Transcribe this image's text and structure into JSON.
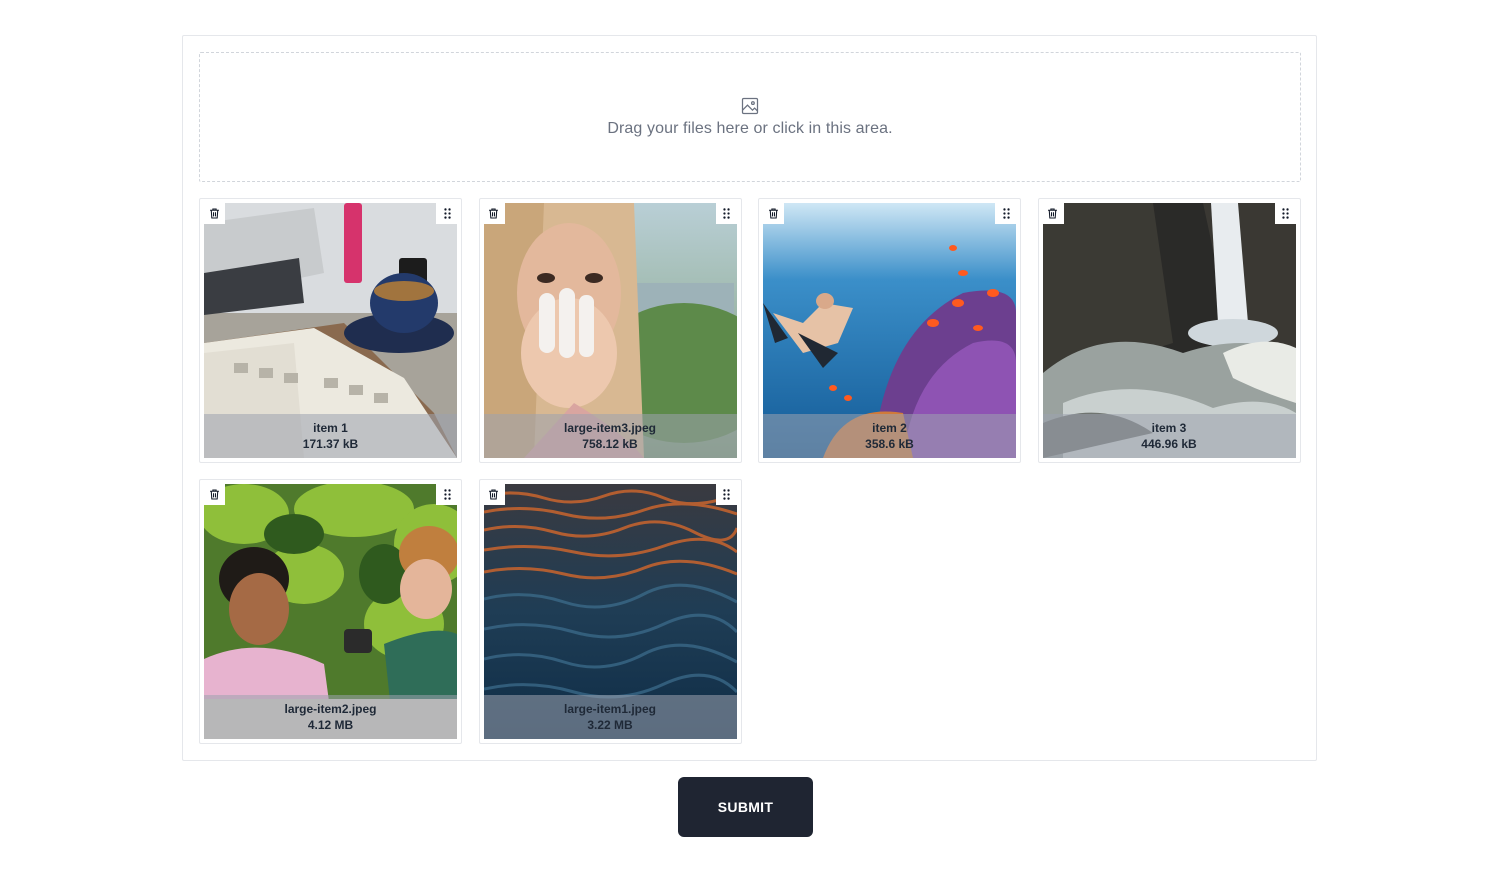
{
  "dropzone": {
    "icon": "image-icon",
    "text": "Drag your files here or click in this area."
  },
  "files": [
    {
      "name": "item 1",
      "size": "171.37 kB",
      "scene": "laptop-coffee"
    },
    {
      "name": "large-item3.jpeg",
      "size": "758.12 kB",
      "scene": "woman-portrait"
    },
    {
      "name": "item 2",
      "size": "358.6 kB",
      "scene": "underwater-reef"
    },
    {
      "name": "item 3",
      "size": "446.96 kB",
      "scene": "waterfall"
    },
    {
      "name": "large-item2.jpeg",
      "size": "4.12 MB",
      "scene": "friends-garden"
    },
    {
      "name": "large-item1.jpeg",
      "size": "3.22 MB",
      "scene": "water-surface"
    }
  ],
  "tile_icons": {
    "delete": "trash-icon",
    "reorder": "drag-handle-icon"
  },
  "submit": {
    "label": "SUBMIT"
  }
}
